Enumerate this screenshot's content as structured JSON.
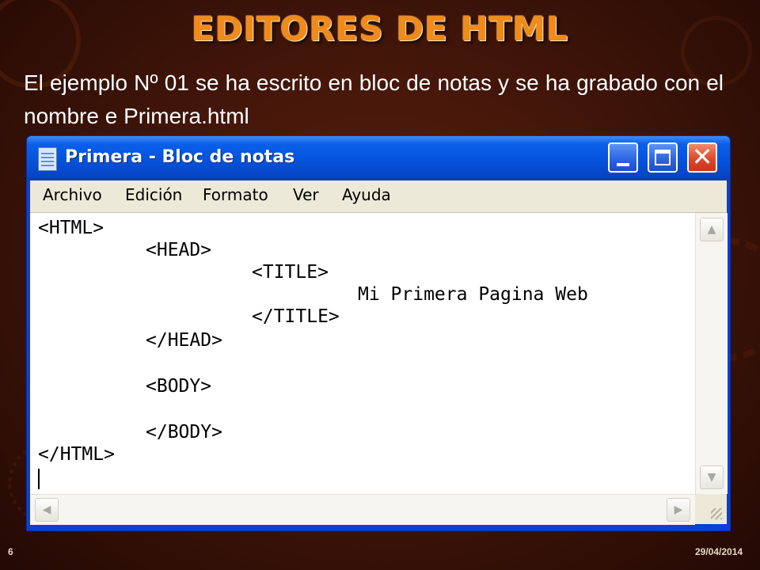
{
  "slide": {
    "title": "EDITORES DE HTML",
    "subtitle": "El ejemplo Nº 01 se ha escrito en bloc de notas y se ha grabado con el nombre e Primera.html",
    "page_number": "6",
    "date": "29/04/2014"
  },
  "window": {
    "title": "Primera - Bloc de notas",
    "icon": "notepad-icon",
    "controls": {
      "minimize": "minimize-icon",
      "maximize": "maximize-icon",
      "close": "✕"
    }
  },
  "menu": {
    "items": [
      {
        "label": "Archivo"
      },
      {
        "label": "Edición"
      },
      {
        "label": "Formato"
      },
      {
        "label": "Ver"
      },
      {
        "label": "Ayuda"
      }
    ]
  },
  "editor": {
    "lines": [
      "<HTML>",
      "<HEAD>",
      "<TITLE>",
      "Mi Primera Pagina Web",
      "</TITLE>",
      "</HEAD>",
      "<BODY>",
      "</BODY>",
      "</HTML>"
    ]
  },
  "scrollbar": {
    "up": "▲",
    "down": "▼",
    "left": "◀",
    "right": "▶"
  },
  "colors": {
    "background": "#46170a",
    "title": "#f08a1a",
    "titlebar": "#0654de",
    "menubar": "#ece9d8"
  }
}
